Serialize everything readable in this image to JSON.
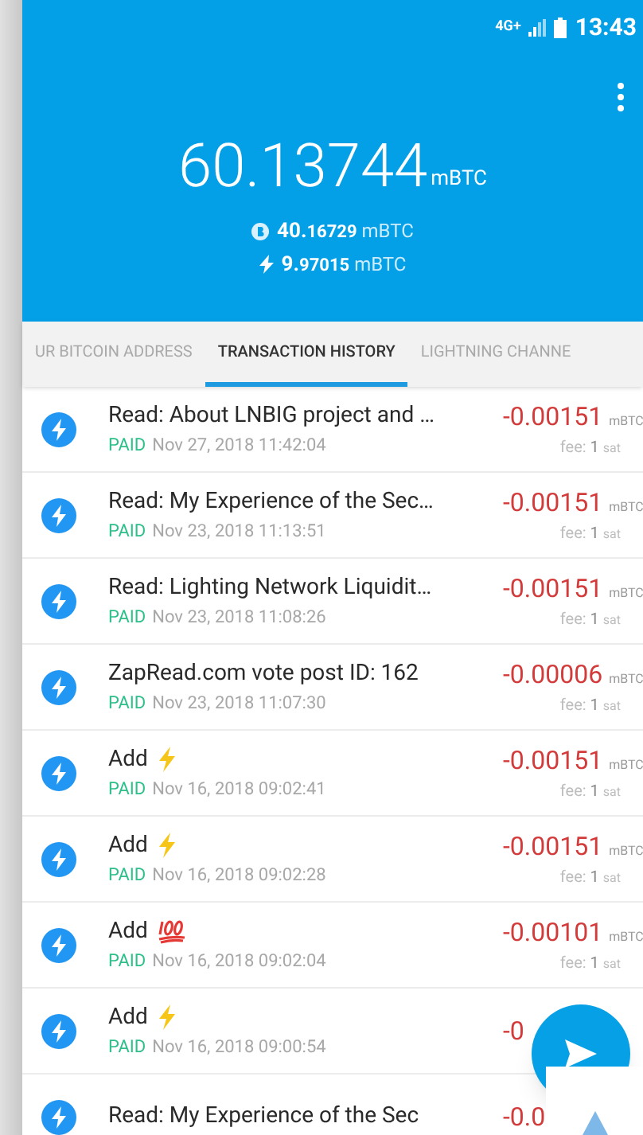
{
  "status_bar": {
    "network": "4G+",
    "time": "13:43"
  },
  "balance": {
    "integer": "60",
    "fraction": ".13744",
    "unit": "mBTC",
    "onchain": {
      "whole": "40.",
      "fraction": "16729",
      "unit": "mBTC"
    },
    "lightning": {
      "whole": "9.",
      "fraction": "97015",
      "unit": "mBTC"
    }
  },
  "tabs": [
    {
      "label": "UR BITCOIN ADDRESS",
      "selected": false
    },
    {
      "label": "TRANSACTION HISTORY",
      "selected": true
    },
    {
      "label": "LIGHTNING CHANNE",
      "selected": false
    }
  ],
  "transactions": [
    {
      "title": "Read: About LNBIG project and …",
      "kind": "plain",
      "status": "PAID",
      "date": "Nov 27, 2018 11:42:04",
      "amount": "-0.00151",
      "unit": "mBTC",
      "fee_label": "fee:",
      "fee": "1",
      "fee_unit": "sat"
    },
    {
      "title": "Read: My Experience of the Sec…",
      "kind": "plain",
      "status": "PAID",
      "date": "Nov 23, 2018 11:13:51",
      "amount": "-0.00151",
      "unit": "mBTC",
      "fee_label": "fee:",
      "fee": "1",
      "fee_unit": "sat"
    },
    {
      "title": "Read: Lighting Network Liquidit…",
      "kind": "plain",
      "status": "PAID",
      "date": "Nov 23, 2018 11:08:26",
      "amount": "-0.00151",
      "unit": "mBTC",
      "fee_label": "fee:",
      "fee": "1",
      "fee_unit": "sat"
    },
    {
      "title": "ZapRead.com vote post ID: 162",
      "kind": "plain",
      "status": "PAID",
      "date": "Nov 23, 2018 11:07:30",
      "amount": "-0.00006",
      "unit": "mBTC",
      "fee_label": "fee:",
      "fee": "1",
      "fee_unit": "sat"
    },
    {
      "title": "Add",
      "kind": "bolt",
      "status": "PAID",
      "date": "Nov 16, 2018 09:02:41",
      "amount": "-0.00151",
      "unit": "mBTC",
      "fee_label": "fee:",
      "fee": "1",
      "fee_unit": "sat"
    },
    {
      "title": "Add",
      "kind": "bolt",
      "status": "PAID",
      "date": "Nov 16, 2018 09:02:28",
      "amount": "-0.00151",
      "unit": "mBTC",
      "fee_label": "fee:",
      "fee": "1",
      "fee_unit": "sat"
    },
    {
      "title": "Add",
      "kind": "hundred",
      "status": "PAID",
      "date": "Nov 16, 2018 09:02:04",
      "amount": "-0.00101",
      "unit": "mBTC",
      "fee_label": "fee:",
      "fee": "1",
      "fee_unit": "sat"
    },
    {
      "title": "Add",
      "kind": "bolt",
      "status": "PAID",
      "date": "Nov 16, 2018 09:00:54",
      "amount": "-0"
    },
    {
      "title": "Read: My Experience of the Sec",
      "kind": "cut",
      "amount": "-0.0"
    }
  ]
}
